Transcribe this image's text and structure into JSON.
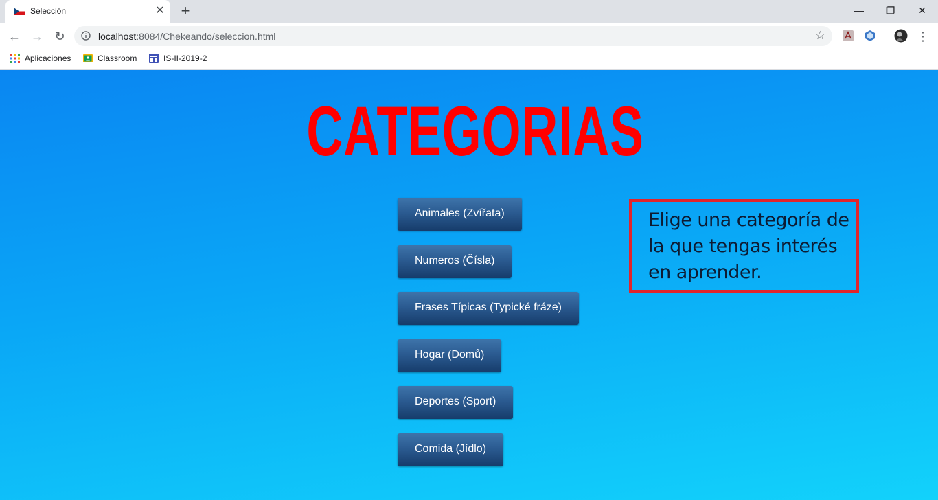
{
  "browser": {
    "tab_title": "Selección",
    "new_tab": "+",
    "url_host": "localhost",
    "url_rest": ":8084/Chekeando/seleccion.html",
    "bookmarks": [
      "Aplicaciones",
      "Classroom",
      "IS-II-2019-2"
    ]
  },
  "page": {
    "heading": "CATEGORIAS",
    "categories": [
      "Animales (Zvířata)",
      "Numeros (Čísla)",
      "Frases Típicas (Typické fráze)",
      "Hogar (Domů)",
      "Deportes (Sport)",
      "Comida (Jídlo)"
    ],
    "info_text": "Elige una categoría de la que tengas interés en aprender."
  },
  "colors": {
    "heading": "#ff0000",
    "button_top": "#3e74aa",
    "button_bottom": "#163c6b",
    "info_border": "#e3242b",
    "background_top": "#0a86f2",
    "background_bottom": "#12d2fb"
  }
}
